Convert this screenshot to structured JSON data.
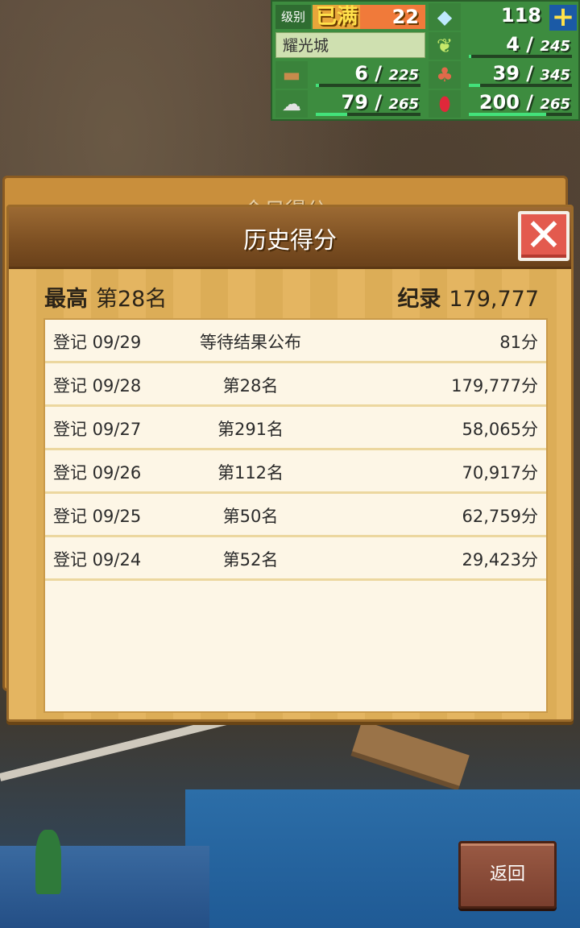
{
  "hud": {
    "level_label": "级别",
    "level_status": "已满",
    "level_value": "22",
    "gems": "118",
    "town_name": "耀光城",
    "grass_current": "4",
    "grass_max": "245",
    "wood_current": "6",
    "wood_max": "225",
    "food_current": "39",
    "food_max": "345",
    "ore_current": "79",
    "ore_max": "265",
    "ruby_current": "200",
    "ruby_max": "265",
    "plus": "+"
  },
  "back_panel": {
    "title": "今日得分"
  },
  "panel": {
    "title": "历史得分",
    "close": "✕",
    "best_label": "最高",
    "best_rank": "第28名",
    "record_label": "纪录",
    "record_value": "179,777"
  },
  "history": [
    {
      "date": "登记 09/29",
      "rank": "等待结果公布",
      "score": "81分"
    },
    {
      "date": "登记 09/28",
      "rank": "第28名",
      "score": "179,777分"
    },
    {
      "date": "登记 09/27",
      "rank": "第291名",
      "score": "58,065分"
    },
    {
      "date": "登记 09/26",
      "rank": "第112名",
      "score": "70,917分"
    },
    {
      "date": "登记 09/25",
      "rank": "第50名",
      "score": "62,759分"
    },
    {
      "date": "登记 09/24",
      "rank": "第52名",
      "score": "29,423分"
    }
  ],
  "back_button": "返回"
}
